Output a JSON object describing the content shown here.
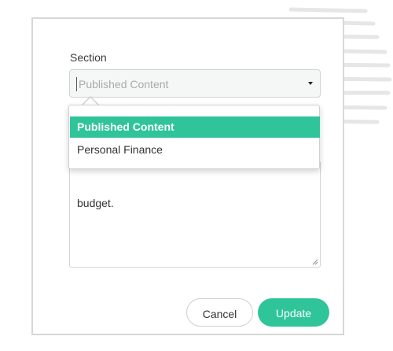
{
  "form": {
    "section_label": "Section",
    "section_select": {
      "value": "Published Content",
      "options": [
        "Published Content",
        "Personal Finance"
      ]
    },
    "description_text": "budget."
  },
  "dropdown": {
    "options": [
      {
        "label": "Published Content",
        "selected": true
      },
      {
        "label": "Personal Finance",
        "selected": false
      }
    ]
  },
  "actions": {
    "cancel_label": "Cancel",
    "update_label": "Update"
  },
  "colors": {
    "accent": "#2fc49a",
    "border": "#d7d7d7"
  }
}
